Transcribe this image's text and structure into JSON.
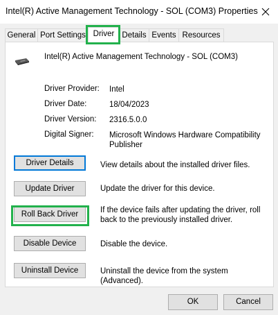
{
  "window": {
    "title": "Intel(R) Active Management Technology - SOL (COM3) Properties"
  },
  "tabs": [
    {
      "label": "General"
    },
    {
      "label": "Port Settings"
    },
    {
      "label": "Driver",
      "active": true
    },
    {
      "label": "Details"
    },
    {
      "label": "Events"
    },
    {
      "label": "Resources"
    }
  ],
  "device": {
    "name": "Intel(R) Active Management Technology - SOL (COM3)",
    "icon": "serial-port-icon"
  },
  "info": {
    "provider_label": "Driver Provider:",
    "provider": "Intel",
    "date_label": "Driver Date:",
    "date": "18/04/2023",
    "version_label": "Driver Version:",
    "version": "2316.5.0.0",
    "signer_label": "Digital Signer:",
    "signer": "Microsoft Windows Hardware Compatibility Publisher"
  },
  "actions": {
    "details_label": "Driver Details",
    "details_desc": "View details about the installed driver files.",
    "update_label": "Update Driver",
    "update_desc": "Update the driver for this device.",
    "rollback_label": "Roll Back Driver",
    "rollback_desc": "If the device fails after updating the driver, roll back to the previously installed driver.",
    "disable_label": "Disable Device",
    "disable_desc": "Disable the device.",
    "uninstall_label": "Uninstall Device",
    "uninstall_desc": "Uninstall the device from the system (Advanced)."
  },
  "footer": {
    "ok_label": "OK",
    "cancel_label": "Cancel"
  },
  "colors": {
    "highlight": "#22b14c",
    "focus": "#0078d7"
  }
}
